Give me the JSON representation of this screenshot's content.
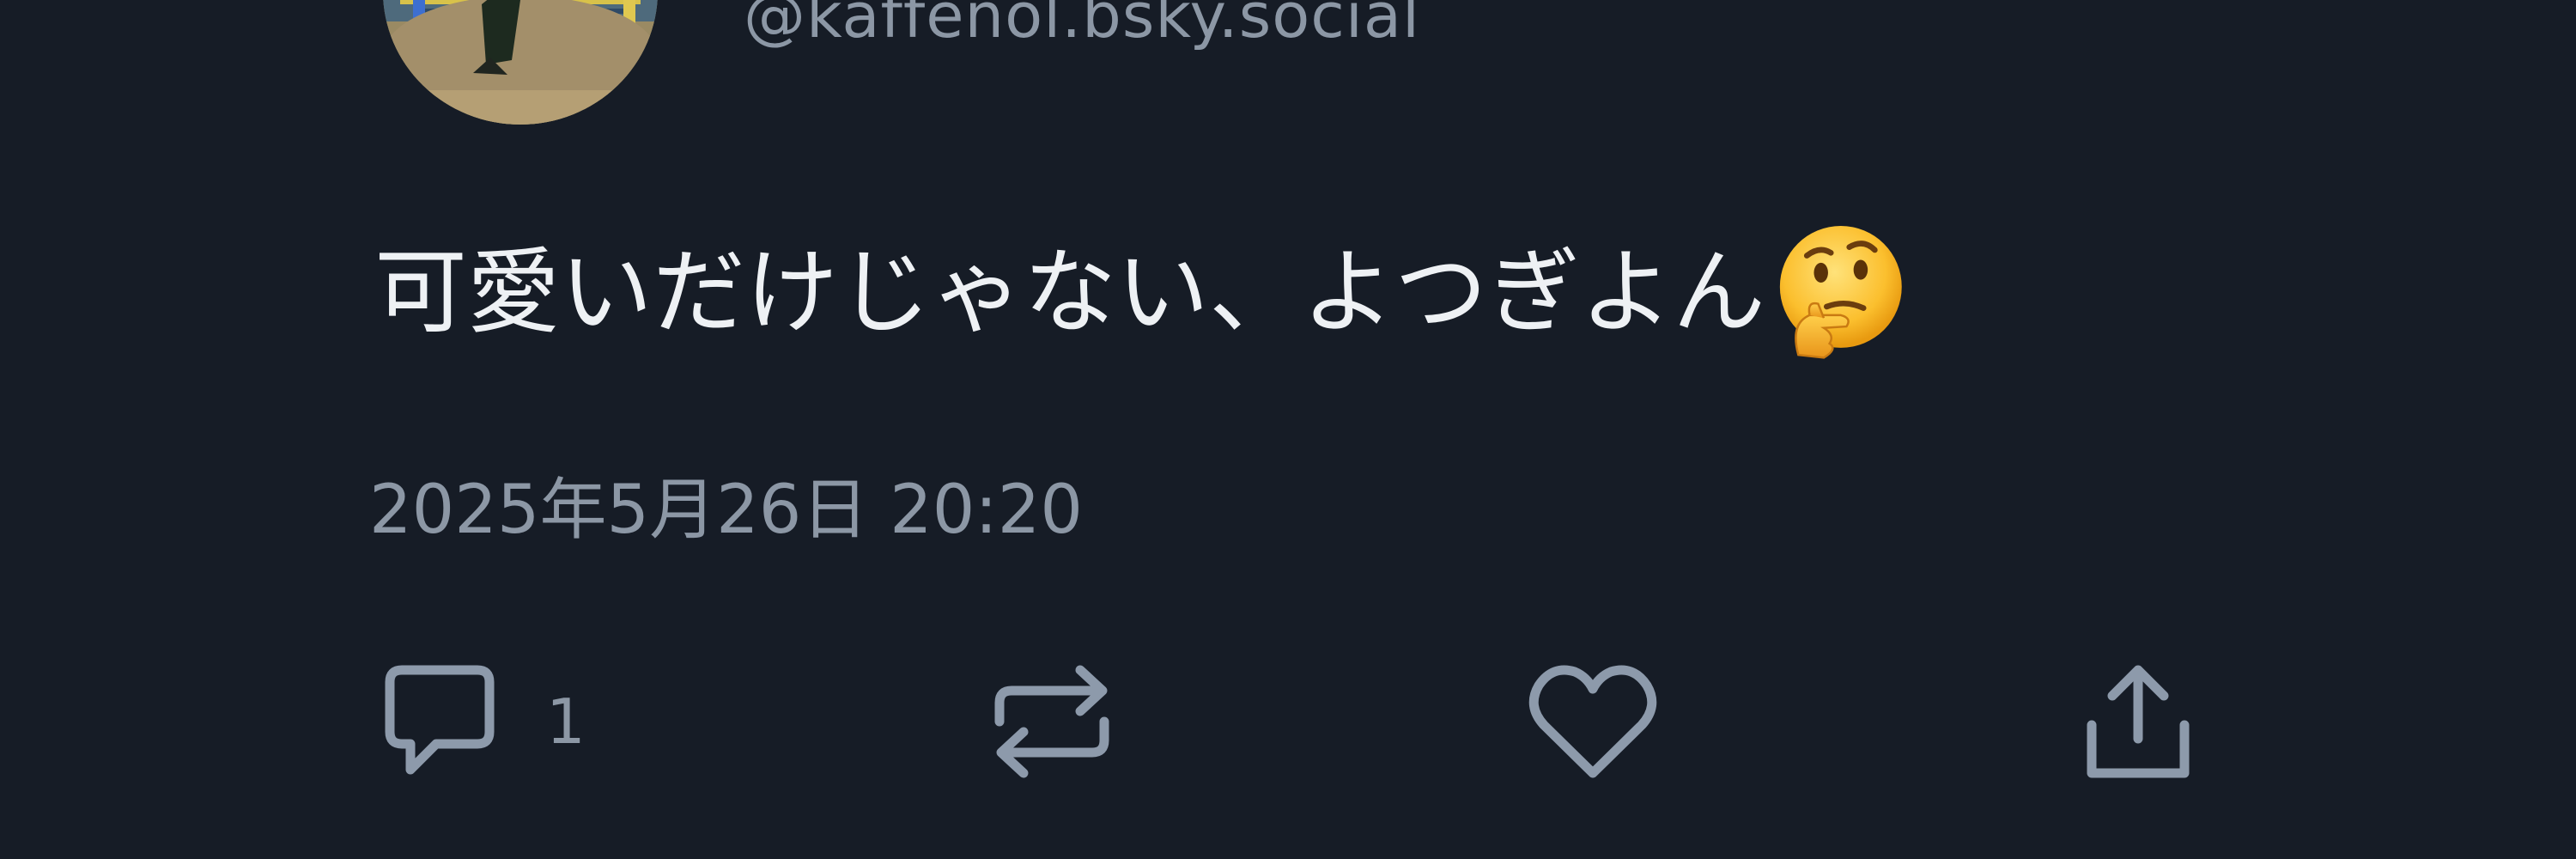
{
  "post": {
    "author_handle": "@kaffenol.bsky.social",
    "text": "可愛いだけじゃない、よつぎよん",
    "emoji": "thinking-face",
    "timestamp": "2025年5月26日 20:20"
  },
  "actions": {
    "reply": {
      "icon": "reply-icon",
      "count": "1"
    },
    "repost": {
      "icon": "repost-icon"
    },
    "like": {
      "icon": "heart-icon"
    },
    "share": {
      "icon": "share-icon"
    }
  },
  "colors": {
    "background": "#161c26",
    "text": "#eef1f4",
    "muted": "#8c97a5",
    "icon": "#8d9aab"
  }
}
